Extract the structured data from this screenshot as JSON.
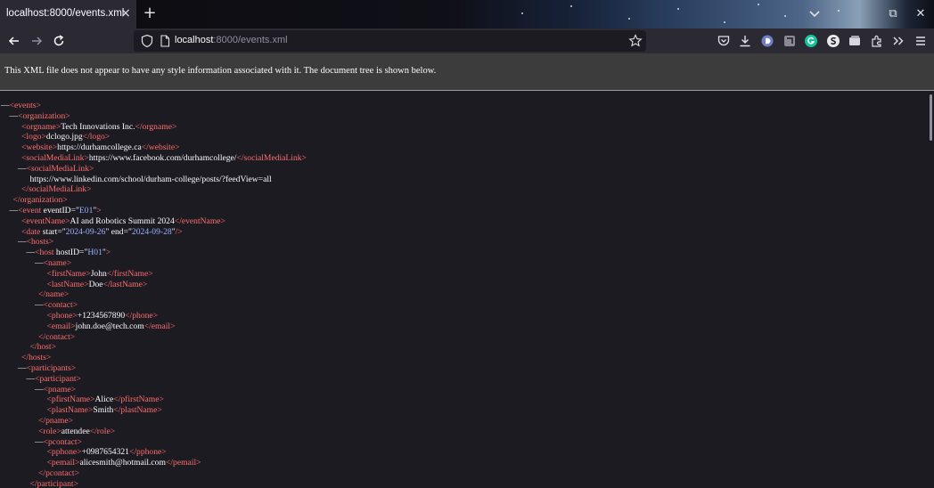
{
  "tab": {
    "title": "localhost:8000/events.xml",
    "close": "×",
    "new": "+"
  },
  "window": {
    "restore": "⧉",
    "close": "✕"
  },
  "url": {
    "host": "localhost",
    "path": ":8000/events.xml"
  },
  "info": "This XML file does not appear to have any style information associated with it. The document tree is shown below.",
  "tree": [
    {
      "indent": 0,
      "c": "—",
      "t": "open",
      "name": "events"
    },
    {
      "indent": 1,
      "c": "—",
      "t": "open",
      "name": "organization"
    },
    {
      "indent": 2,
      "t": "leaf",
      "name": "orgname",
      "text": "Tech Innovations Inc."
    },
    {
      "indent": 2,
      "t": "leaf",
      "name": "logo",
      "text": "dclogo.jpg"
    },
    {
      "indent": 2,
      "t": "leaf",
      "name": "website",
      "text": "https://durhamcollege.ca"
    },
    {
      "indent": 2,
      "t": "leaf",
      "name": "socialMediaLink",
      "text": "https://www.facebook.com/durhamcollege/"
    },
    {
      "indent": 2,
      "c": "—",
      "t": "open",
      "name": "socialMediaLink"
    },
    {
      "indent": 3,
      "t": "text",
      "text": "https://www.linkedin.com/school/durham-college/posts/?feedView=all"
    },
    {
      "indent": 2,
      "t": "close",
      "name": "socialMediaLink"
    },
    {
      "indent": 1,
      "t": "close",
      "name": "organization"
    },
    {
      "indent": 1,
      "c": "—",
      "t": "open",
      "name": "event",
      "attrs": [
        {
          "n": "eventID",
          "v": "E01"
        }
      ]
    },
    {
      "indent": 2,
      "t": "leaf",
      "name": "eventName",
      "text": "AI and Robotics Summit 2024"
    },
    {
      "indent": 2,
      "t": "empty",
      "name": "date",
      "attrs": [
        {
          "n": "start",
          "v": "2024-09-26"
        },
        {
          "n": "end",
          "v": "2024-09-28"
        }
      ]
    },
    {
      "indent": 2,
      "c": "—",
      "t": "open",
      "name": "hosts"
    },
    {
      "indent": 3,
      "c": "—",
      "t": "open",
      "name": "host",
      "attrs": [
        {
          "n": "hostID",
          "v": "H01"
        }
      ]
    },
    {
      "indent": 4,
      "c": "—",
      "t": "open",
      "name": "name"
    },
    {
      "indent": 5,
      "t": "leaf",
      "name": "firstName",
      "text": "John"
    },
    {
      "indent": 5,
      "t": "leaf",
      "name": "lastName",
      "text": "Doe"
    },
    {
      "indent": 4,
      "t": "close",
      "name": "name"
    },
    {
      "indent": 4,
      "c": "—",
      "t": "open",
      "name": "contact"
    },
    {
      "indent": 5,
      "t": "leaf",
      "name": "phone",
      "text": "+1234567890"
    },
    {
      "indent": 5,
      "t": "leaf",
      "name": "email",
      "text": "john.doe@tech.com"
    },
    {
      "indent": 4,
      "t": "close",
      "name": "contact"
    },
    {
      "indent": 3,
      "t": "close",
      "name": "host"
    },
    {
      "indent": 2,
      "t": "close",
      "name": "hosts"
    },
    {
      "indent": 2,
      "c": "—",
      "t": "open",
      "name": "participants"
    },
    {
      "indent": 3,
      "c": "—",
      "t": "open",
      "name": "participant"
    },
    {
      "indent": 4,
      "c": "—",
      "t": "open",
      "name": "pname"
    },
    {
      "indent": 5,
      "t": "leaf",
      "name": "pfirstName",
      "text": "Alice"
    },
    {
      "indent": 5,
      "t": "leaf",
      "name": "plastName",
      "text": "Smith"
    },
    {
      "indent": 4,
      "t": "close",
      "name": "pname"
    },
    {
      "indent": 4,
      "t": "leaf",
      "name": "role",
      "text": "attendee"
    },
    {
      "indent": 4,
      "c": "—",
      "t": "open",
      "name": "pcontact"
    },
    {
      "indent": 5,
      "t": "leaf",
      "name": "pphone",
      "text": "+0987654321"
    },
    {
      "indent": 5,
      "t": "leaf",
      "name": "pemail",
      "text": "alicesmith@hotmail.com"
    },
    {
      "indent": 4,
      "t": "close",
      "name": "pcontact"
    },
    {
      "indent": 3,
      "t": "close",
      "name": "participant"
    }
  ]
}
